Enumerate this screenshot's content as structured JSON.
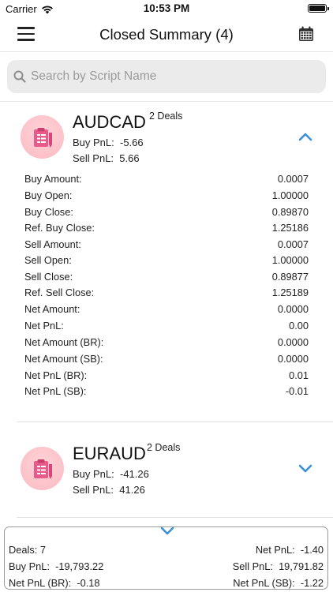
{
  "status": {
    "carrier": "Carrier",
    "time": "10:53 PM"
  },
  "nav": {
    "title": "Closed Summary (4)",
    "menu_icon": "hamburger-icon",
    "calendar_icon": "calendar-icon"
  },
  "search": {
    "placeholder": "Search by Script Name",
    "value": ""
  },
  "colors": {
    "accent": "#3d8fd6",
    "icon_bg": "#fbb9c2",
    "icon_fg": "#e85a8a"
  },
  "cards": [
    {
      "name": "AUDCAD",
      "deals": "2 Deals",
      "buy_pnl_label": "Buy PnL:",
      "buy_pnl": "-5.66",
      "sell_pnl_label": "Sell PnL:",
      "sell_pnl": "5.66",
      "expanded": true,
      "details": [
        {
          "label": "Buy Amount:",
          "value": "0.0007"
        },
        {
          "label": "Buy Open:",
          "value": "1.00000"
        },
        {
          "label": "Buy Close:",
          "value": "0.89870"
        },
        {
          "label": "Ref. Buy Close:",
          "value": "1.25186"
        },
        {
          "label": "Sell Amount:",
          "value": "0.0007"
        },
        {
          "label": "Sell Open:",
          "value": "1.00000"
        },
        {
          "label": "Sell Close:",
          "value": "0.89877"
        },
        {
          "label": "Ref. Sell Close:",
          "value": "1.25189"
        },
        {
          "label": "Net Amount:",
          "value": "0.0000"
        },
        {
          "label": "Net PnL:",
          "value": "0.00"
        },
        {
          "label": "Net Amount (BR):",
          "value": "0.0000"
        },
        {
          "label": "Net Amount (SB):",
          "value": "0.0000"
        },
        {
          "label": "Net PnL (BR):",
          "value": "0.01"
        },
        {
          "label": "Net PnL (SB):",
          "value": "-0.01"
        }
      ]
    },
    {
      "name": "EURAUD",
      "deals": "2 Deals",
      "buy_pnl_label": "Buy PnL:",
      "buy_pnl": "-41.26",
      "sell_pnl_label": "Sell PnL:",
      "sell_pnl": "41.26",
      "expanded": false
    }
  ],
  "footer": {
    "deals_label": "Deals:",
    "deals": "7",
    "net_pnl_label": "Net PnL:",
    "net_pnl": "-1.40",
    "buy_pnl_label": "Buy PnL:",
    "buy_pnl": "-19,793.22",
    "sell_pnl_label": "Sell PnL:",
    "sell_pnl": "19,791.82",
    "net_pnl_br_label": "Net PnL (BR):",
    "net_pnl_br": "-0.18",
    "net_pnl_sb_label": "Net PnL (SB):",
    "net_pnl_sb": "-1.22"
  }
}
